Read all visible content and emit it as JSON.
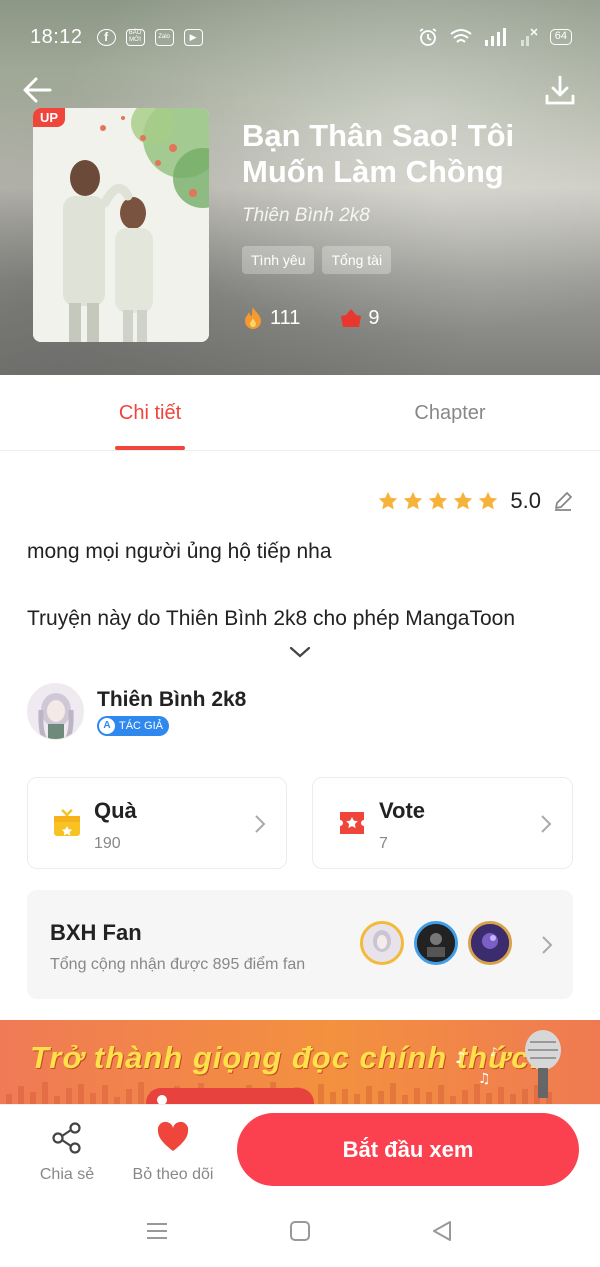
{
  "status_bar": {
    "time": "18:12",
    "apps": [
      "f",
      "BÁO MỚI",
      "Zalo",
      "▶"
    ],
    "battery": "64"
  },
  "book": {
    "title": "Bạn Thân Sao! Tôi Muốn Làm Chồng",
    "author": "Thiên Bình 2k8",
    "badge": "UP",
    "tags": [
      "Tình yêu",
      "Tổng tài"
    ],
    "views": "111",
    "likes": "9"
  },
  "tabs": {
    "details": "Chi tiết",
    "chapter": "Chapter"
  },
  "rating": {
    "value": "5.0",
    "stars": 5
  },
  "description": {
    "line1": "mong mọi người ủng hộ tiếp nha",
    "line2": "Truyện này do Thiên Bình 2k8 cho phép MangaToon"
  },
  "author_section": {
    "name": "Thiên Bình 2k8",
    "badge": "TÁC GIẢ"
  },
  "gift_card": {
    "title": "Quà",
    "count": "190"
  },
  "vote_card": {
    "title": "Vote",
    "count": "7"
  },
  "fan_rank": {
    "title": "BXH Fan",
    "subtitle": "Tổng cộng nhận được 895 điểm fan"
  },
  "banner": {
    "text": "Trở thành giọng đọc chính thức!"
  },
  "bottom_bar": {
    "share_label": "Chia sẻ",
    "unfollow_label": "Bỏ theo dõi",
    "start_label": "Bắt đầu xem"
  },
  "colors": {
    "accent": "#f0453a",
    "button": "#fb4150",
    "star": "#f6b33c"
  }
}
